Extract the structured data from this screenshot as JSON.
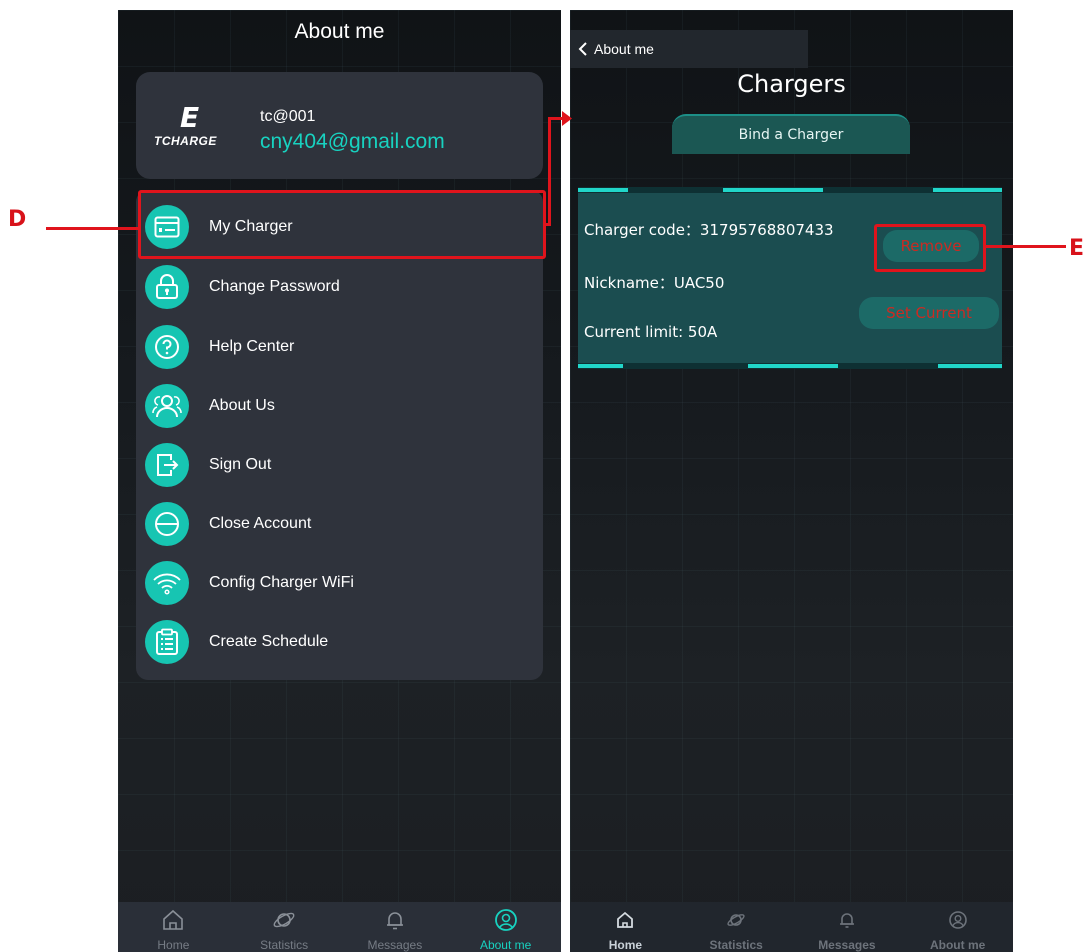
{
  "left_screen": {
    "title": "About me",
    "profile": {
      "logo_mark": "E",
      "logo_text": "TCHARGE",
      "username": "tc@001",
      "email": "cny404@gmail.com"
    },
    "menu": [
      {
        "label": "My Charger",
        "icon": "charger-card-icon"
      },
      {
        "label": "Change Password",
        "icon": "lock-icon"
      },
      {
        "label": "Help Center",
        "icon": "help-icon"
      },
      {
        "label": "About Us",
        "icon": "users-icon"
      },
      {
        "label": "Sign Out",
        "icon": "sign-out-icon"
      },
      {
        "label": "Close Account",
        "icon": "minus-circle-icon"
      },
      {
        "label": "Config Charger WiFi",
        "icon": "wifi-icon"
      },
      {
        "label": "Create Schedule",
        "icon": "clipboard-icon"
      }
    ],
    "tabs": [
      {
        "label": "Home",
        "icon": "home-icon"
      },
      {
        "label": "Statistics",
        "icon": "planet-icon"
      },
      {
        "label": "Messages",
        "icon": "bell-icon"
      },
      {
        "label": "About me",
        "icon": "user-circle-icon",
        "active": true
      }
    ]
  },
  "right_screen": {
    "back_label": "About me",
    "title": "Chargers",
    "bind_button": "Bind a Charger",
    "charger": {
      "code_line": "Charger code：31795768807433",
      "nickname_line": "Nickname：UAC50",
      "limit_line": "Current limit: 50A"
    },
    "remove_button": "Remove",
    "set_current_button": "Set Current",
    "tabs": [
      {
        "label": "Home",
        "icon": "home-icon",
        "active": true
      },
      {
        "label": "Statistics",
        "icon": "planet-icon"
      },
      {
        "label": "Messages",
        "icon": "bell-icon"
      },
      {
        "label": "About me",
        "icon": "user-circle-icon"
      }
    ]
  },
  "annotations": {
    "marker_d": "D",
    "marker_e": "E"
  },
  "colors": {
    "accent": "#18d2c0",
    "highlight": "#e0141c",
    "card": "#2f333c"
  }
}
